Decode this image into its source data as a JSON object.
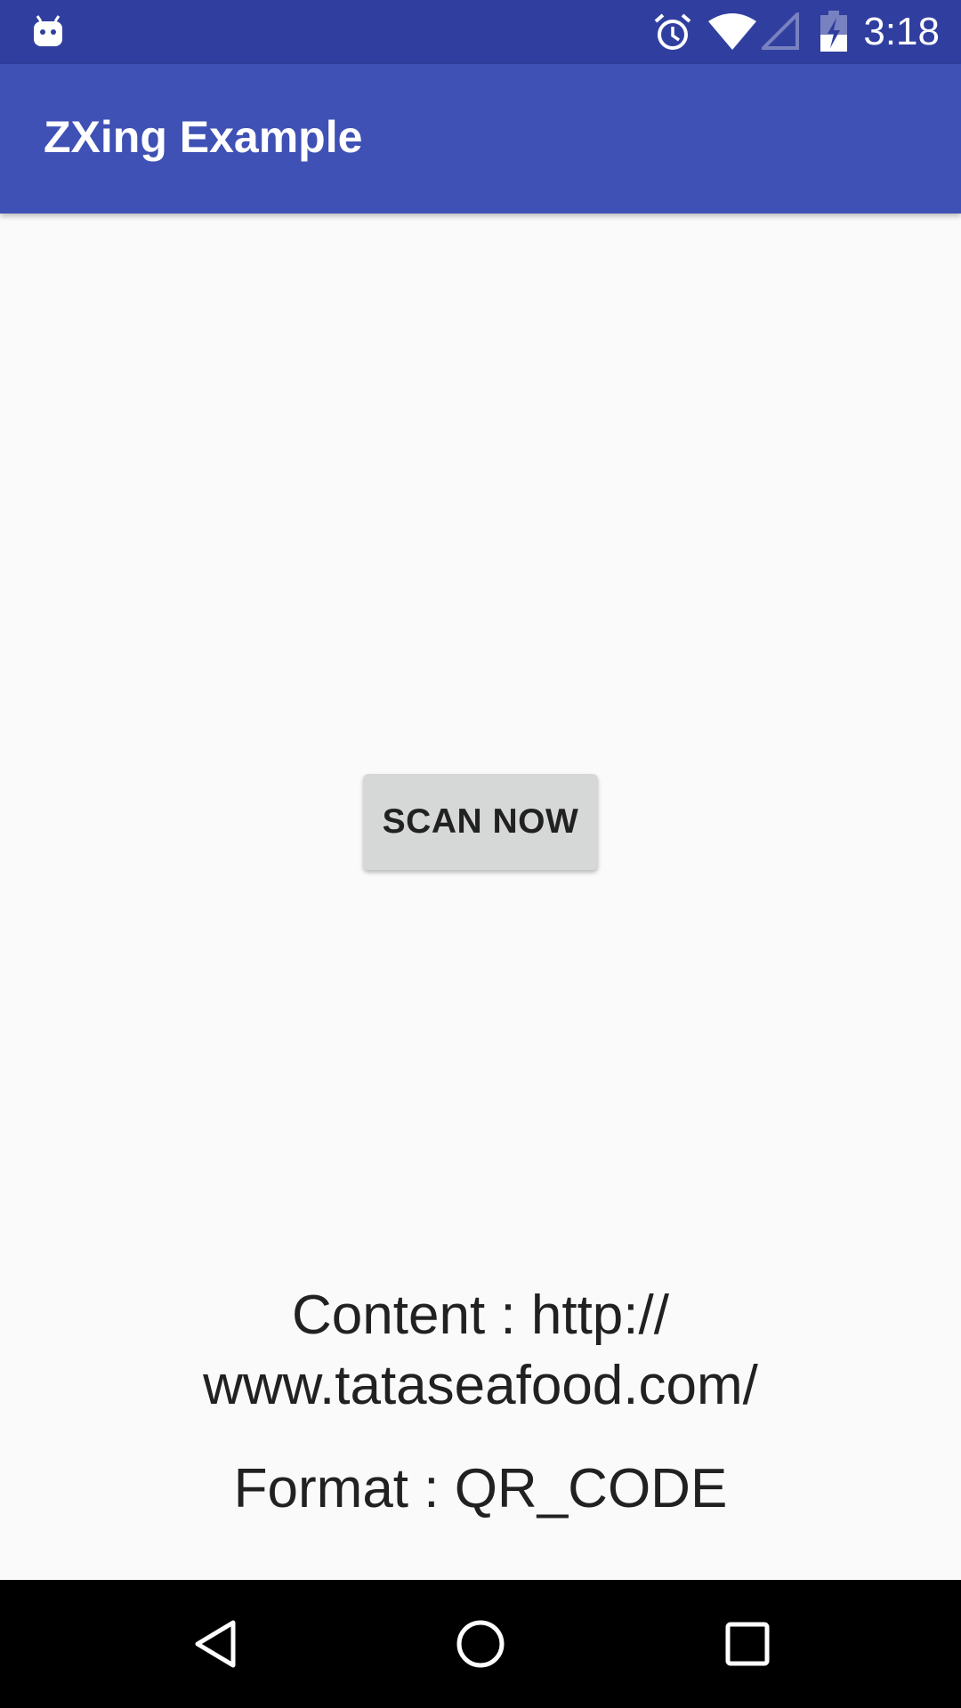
{
  "status_bar": {
    "time": "3:18",
    "icons": [
      "android-notification-icon",
      "alarm-icon",
      "wifi-icon",
      "cell-signal-icon",
      "battery-charging-icon"
    ]
  },
  "app_bar": {
    "title": "ZXing Example"
  },
  "main": {
    "scan_button": "SCAN NOW",
    "content_line1": "Content : http://",
    "content_line2": "www.tataseafood.com/",
    "format": "Format : QR_CODE"
  },
  "nav_bar": {
    "icons": [
      "back-icon",
      "home-icon",
      "recents-icon"
    ]
  },
  "colors": {
    "status": "#303f9f",
    "primary": "#3f51b5",
    "background": "#fafafa"
  }
}
